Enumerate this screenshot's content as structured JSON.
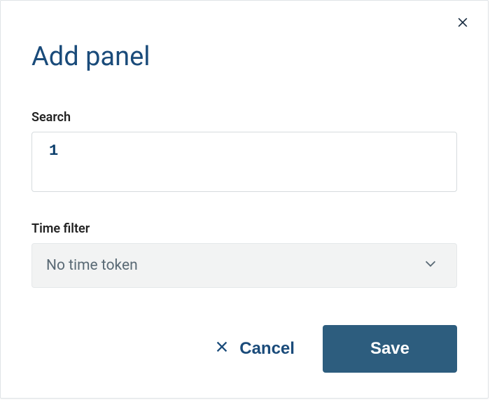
{
  "dialog": {
    "title": "Add panel"
  },
  "search": {
    "label": "Search",
    "value": "1"
  },
  "timeFilter": {
    "label": "Time filter",
    "selected": "No time token"
  },
  "buttons": {
    "cancel": "Cancel",
    "save": "Save"
  }
}
